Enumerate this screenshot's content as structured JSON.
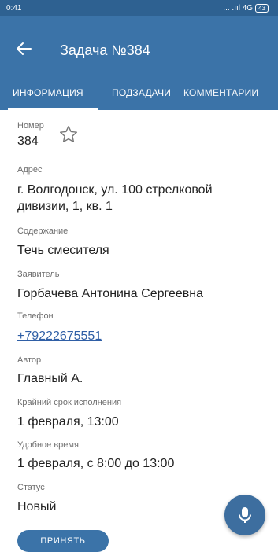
{
  "status_bar": {
    "time": "0:41",
    "signal": "... .ııl 4G",
    "battery": "43"
  },
  "app_bar": {
    "title": "Задача №384"
  },
  "tabs": [
    {
      "label": "ИНФОРМАЦИЯ",
      "active": true
    },
    {
      "label": "ПОДЗАДАЧИ",
      "active": false
    },
    {
      "label": "КОММЕНТАРИИ",
      "active": false
    }
  ],
  "fields": {
    "number": {
      "label": "Номер",
      "value": "384"
    },
    "address": {
      "label": "Адрес",
      "line1": "г. Волгодонск, ул. 100 стрелковой",
      "line2": "дивизии, 1,  кв. 1"
    },
    "content": {
      "label": "Содержание",
      "value": "Течь смесителя"
    },
    "applicant": {
      "label": "Заявитель",
      "value": "Горбачева Антонина Сергеевна"
    },
    "phone": {
      "label": "Телефон",
      "value": "+79222675551"
    },
    "author": {
      "label": "Автор",
      "value": "Главный А."
    },
    "deadline": {
      "label": "Крайний срок исполнения",
      "value": "1 февраля, 13:00"
    },
    "convenient_time": {
      "label": "Удобное время",
      "value": "1 февраля, с 8:00 до 13:00"
    },
    "status": {
      "label": "Статус",
      "value": "Новый"
    }
  },
  "actions": {
    "accept_label": "ПРИНЯТЬ"
  },
  "icons": {
    "back": "arrow-left-icon",
    "star": "star-outline-icon",
    "mic": "microphone-icon"
  },
  "colors": {
    "primary": "#3b73a8",
    "status_bar": "#2e6191",
    "link": "#2f5fa6",
    "fab": "#3d6e9f"
  }
}
